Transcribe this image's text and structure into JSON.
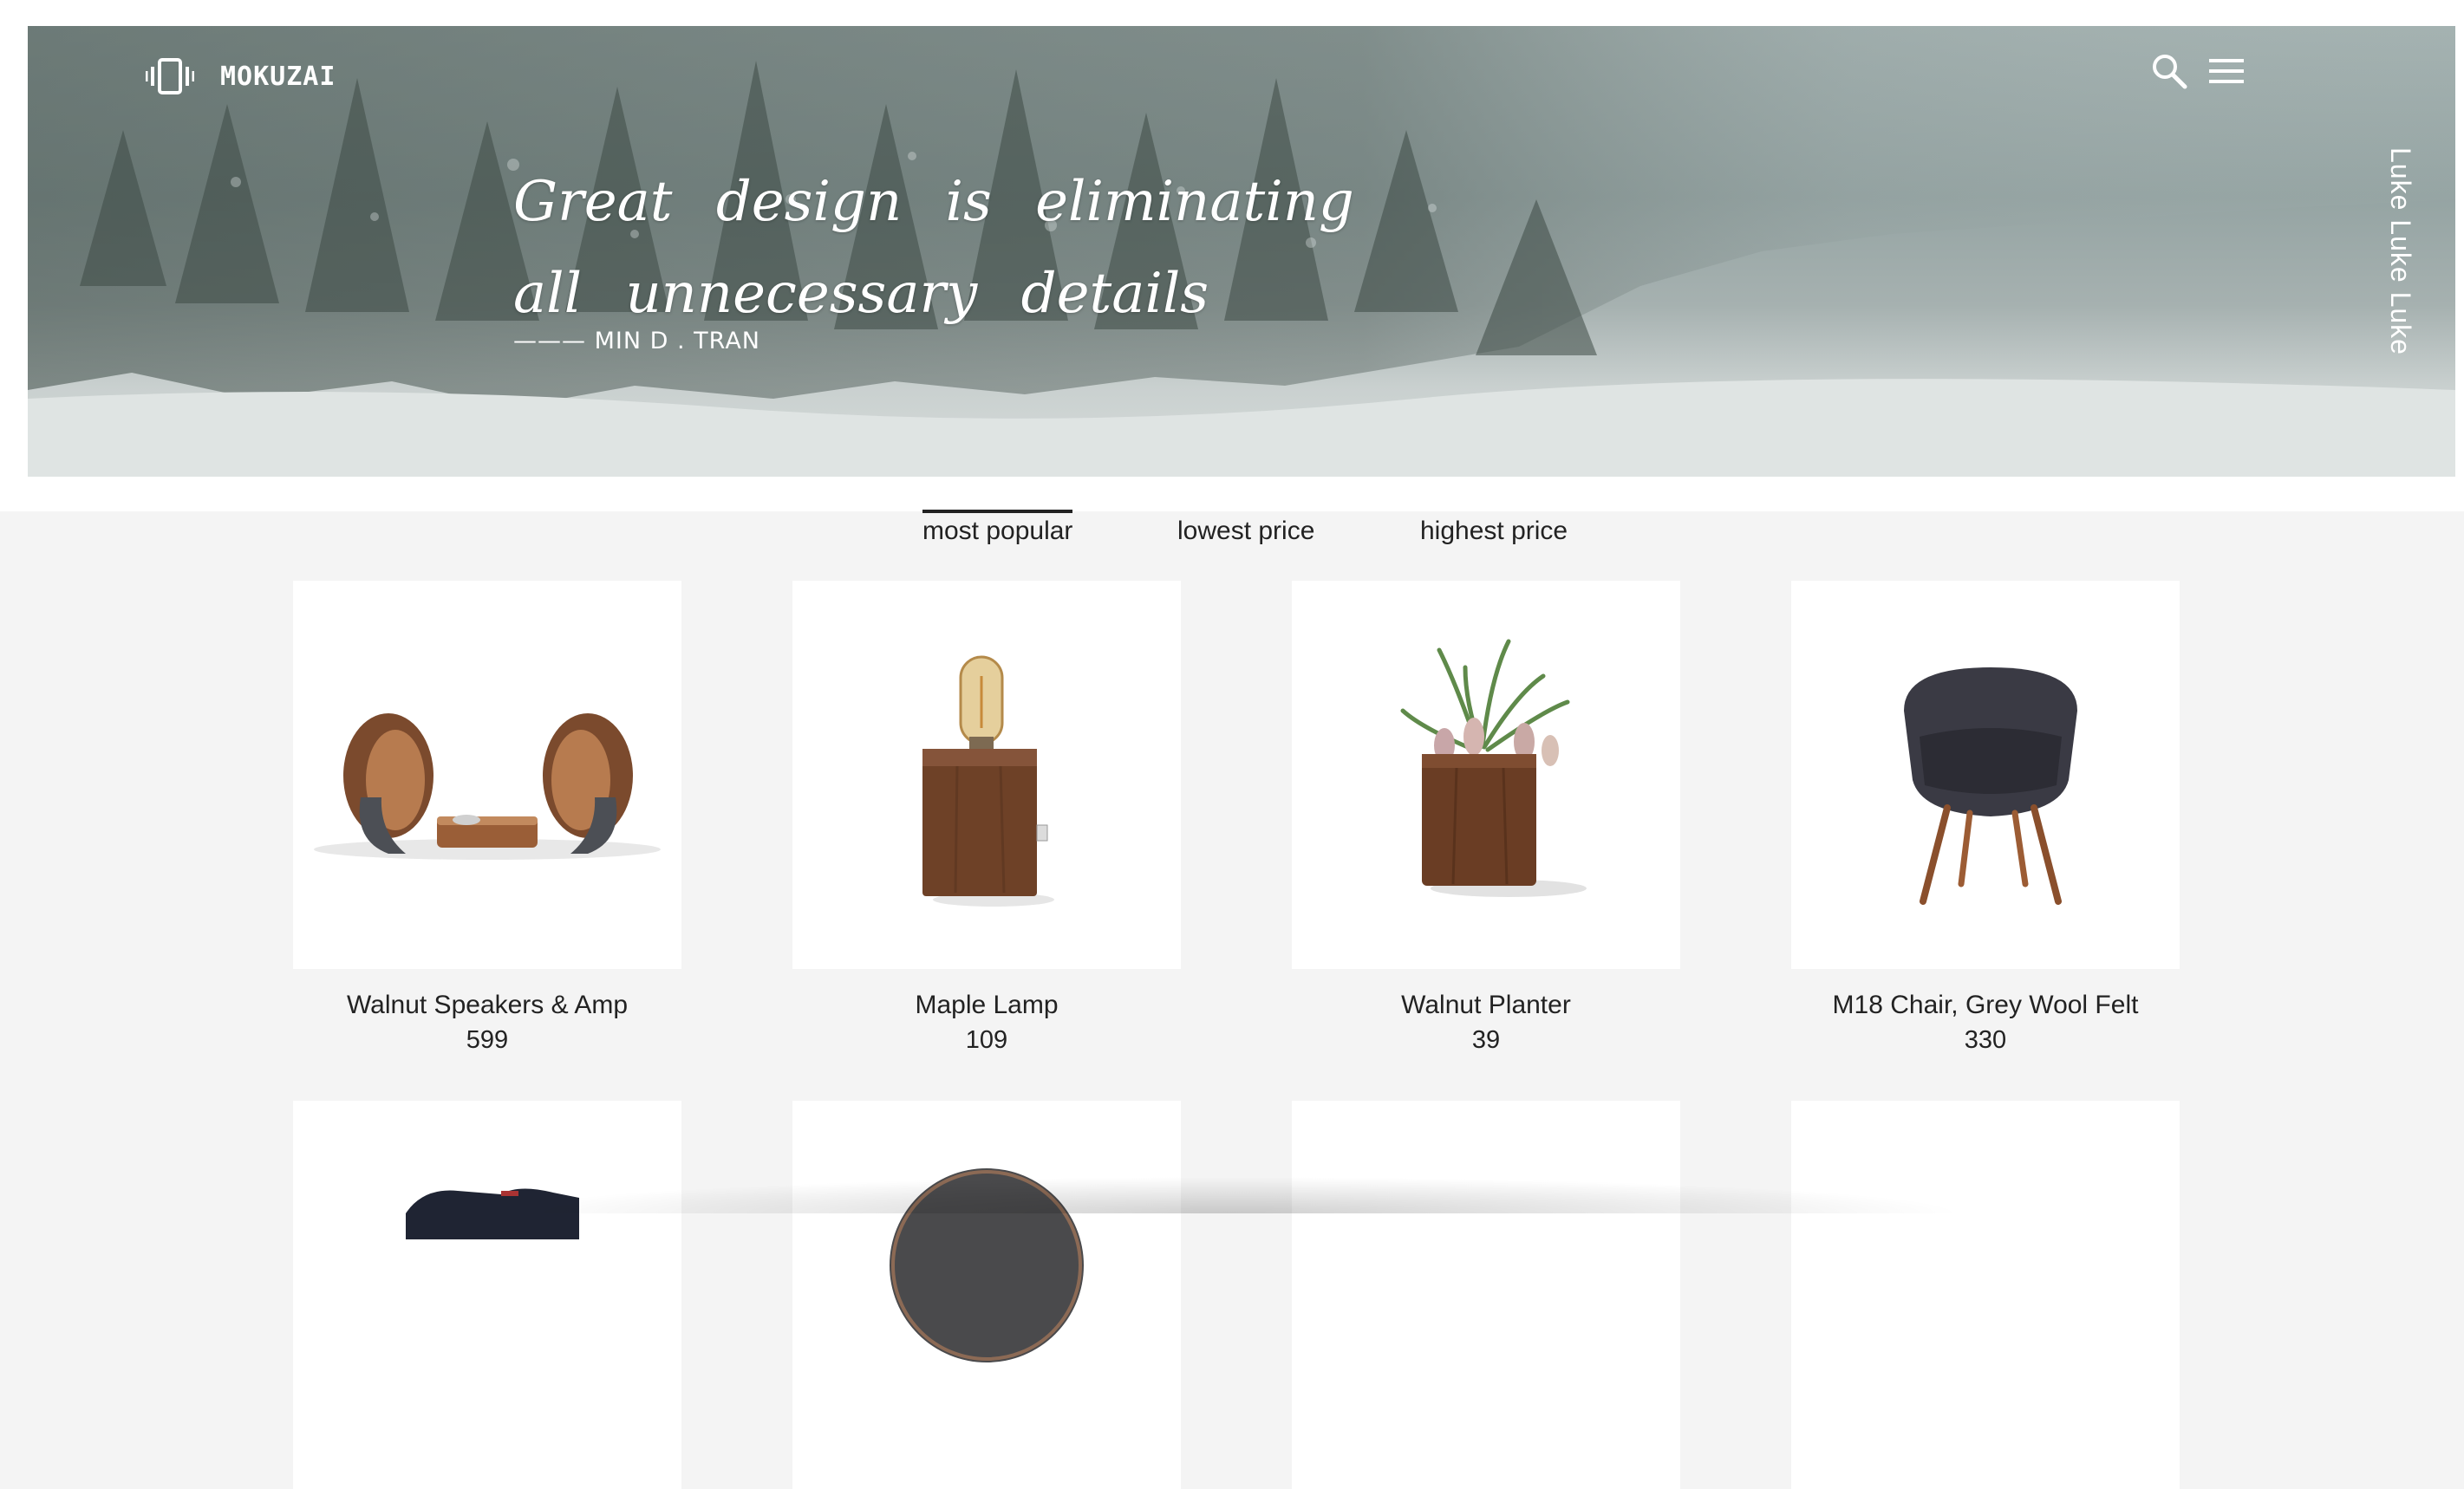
{
  "brand": {
    "name": "MOKUZAI",
    "logo_icon": "vibrate-phone-icon"
  },
  "header": {
    "search_icon": "search-icon",
    "menu_icon": "hamburger-menu-icon"
  },
  "hero": {
    "quote_line1": "Great design is eliminating",
    "quote_line2": "all unnecessary details",
    "author": "——— MIN D . TRAN",
    "side_text": "Luke Luke Luke"
  },
  "sort": {
    "tabs": [
      {
        "label": "most popular",
        "active": true
      },
      {
        "label": "lowest price",
        "active": false
      },
      {
        "label": "highest price",
        "active": false
      }
    ]
  },
  "products": [
    {
      "name": "Walnut Speakers & Amp",
      "price": "599"
    },
    {
      "name": "Maple Lamp",
      "price": "109"
    },
    {
      "name": "Walnut Planter",
      "price": "39"
    },
    {
      "name": "M18 Chair, Grey Wool Felt",
      "price": "330"
    }
  ],
  "colors": {
    "page_bg": "#f4f4f4",
    "hero_tint": "#9aa8a7",
    "text": "#222222",
    "wood": "#7a4a2c"
  }
}
